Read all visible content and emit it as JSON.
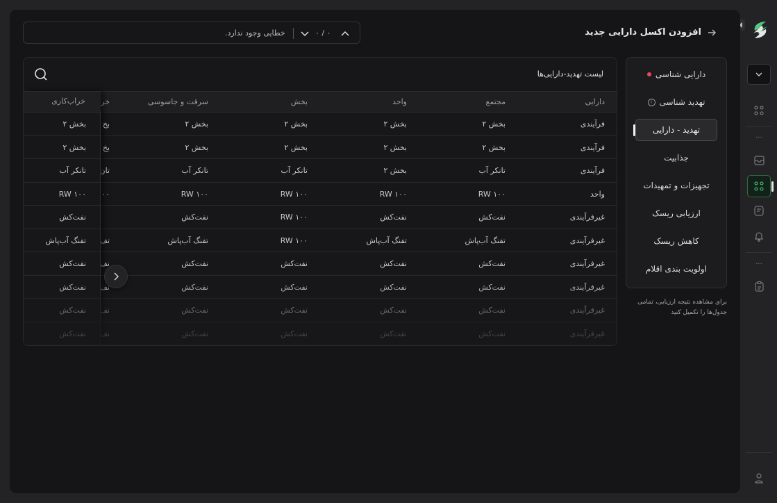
{
  "header": {
    "title": "افزودن اکسل دارایی جدید"
  },
  "errors": {
    "message": "خطایی وجود ندارد.",
    "counter": "۰ / ۰"
  },
  "steps": [
    {
      "label": "دارایی شناسی"
    },
    {
      "label": "تهدید شناسی"
    },
    {
      "label": "تهدید - دارایی"
    },
    {
      "label": "جذابیت"
    },
    {
      "label": "تجهیزات و تمهیدات"
    },
    {
      "label": "ارزیابی ریسک"
    },
    {
      "label": "کاهش ریسک"
    },
    {
      "label": "اولویت بندی اقلام"
    }
  ],
  "hint": "برای مشاهده نتیجه ارزیابی، تمامی جدول‌ها را تکمیل کنید",
  "table": {
    "title": "لیست تهدید-دارایی‌ها",
    "columns": [
      "دارایی",
      "مجتمع",
      "واحد",
      "بخش",
      "سرقت و جاسوسی",
      "خر",
      "خراب‌کاری"
    ],
    "rows": [
      [
        "فرآیندی",
        "بخش ۲",
        "بخش ۲",
        "بخش ۲",
        "بخش ۲",
        "بخ",
        "بخش ۲"
      ],
      [
        "فرآیندی",
        "بخش ۲",
        "بخش ۲",
        "بخش ۲",
        "بخش ۲",
        "بخ",
        "بخش ۲"
      ],
      [
        "فرآیندی",
        "تانکر آب",
        "بخش ۲",
        "تانکر آب",
        "تانکر آب",
        "تان",
        "تانکر آب"
      ],
      [
        "واحد",
        "RW ۱۰۰",
        "RW ۱۰۰",
        "RW ۱۰۰",
        "RW ۱۰۰",
        "۱۰۰",
        "RW ۱۰۰"
      ],
      [
        "غیرفرآیندی",
        "نفت‌کش",
        "نفت‌کش",
        "RW ۱۰۰",
        "نفت‌کش",
        "",
        "نفت‌کش"
      ],
      [
        "غیرفرآیندی",
        "تفنگ آب‌پاش",
        "تفنگ آب‌پاش",
        "RW ۱۰۰",
        "تفنگ آب‌پاش",
        "تف",
        "تفنگ آب‌پاش"
      ],
      [
        "غیرفرآیندی",
        "نفت‌کش",
        "نفت‌کش",
        "نفت‌کش",
        "نفت‌کش",
        "نف",
        "نفت‌کش"
      ],
      [
        "غیرفرآیندی",
        "نفت‌کش",
        "نفت‌کش",
        "نفت‌کش",
        "نفت‌کش",
        "نف",
        "نفت‌کش"
      ],
      [
        "غیرفرآیندی",
        "نفت‌کش",
        "نفت‌کش",
        "نفت‌کش",
        "نفت‌کش",
        "نف",
        "نفت‌کش"
      ],
      [
        "غیرفرآیندی",
        "نفت‌کش",
        "نفت‌کش",
        "نفت‌کش",
        "نفت‌کش",
        "نف",
        "نفت‌کش"
      ]
    ]
  },
  "colors": {
    "accent_green": "#3ea35f",
    "badge_red": "#f0455c"
  },
  "icons": {
    "logo": "brand-logo-icon",
    "search": "search-icon",
    "back": "arrow-right-icon"
  }
}
